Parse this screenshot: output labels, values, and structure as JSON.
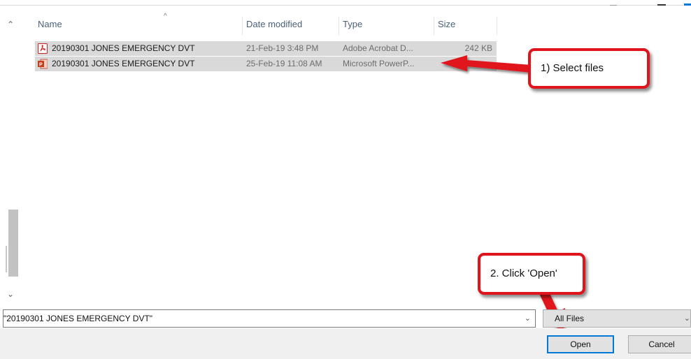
{
  "columns": {
    "name": "Name",
    "date_modified": "Date modified",
    "type": "Type",
    "size": "Size"
  },
  "files": [
    {
      "name": "20190301 JONES EMERGENCY DVT",
      "date_modified": "21-Feb-19 3:48 PM",
      "type": "Adobe Acrobat D...",
      "size": "242 KB",
      "icon": "pdf-file-icon"
    },
    {
      "name": "20190301 JONES EMERGENCY DVT",
      "date_modified": "25-Feb-19 11:08 AM",
      "type": "Microsoft PowerP...",
      "size": "",
      "icon": "powerpoint-file-icon"
    }
  ],
  "callouts": {
    "select_files": "1) Select files",
    "click_open": "2. Click 'Open'"
  },
  "file_name_field": {
    "value": "\"20190301 JONES EMERGENCY DVT\""
  },
  "file_type_filter": {
    "value": "All Files"
  },
  "buttons": {
    "open": "Open",
    "cancel": "Cancel"
  },
  "colors": {
    "callout_red": "#e0141c",
    "selection_gray": "#d9d9d9",
    "accent_blue": "#0078d7"
  }
}
